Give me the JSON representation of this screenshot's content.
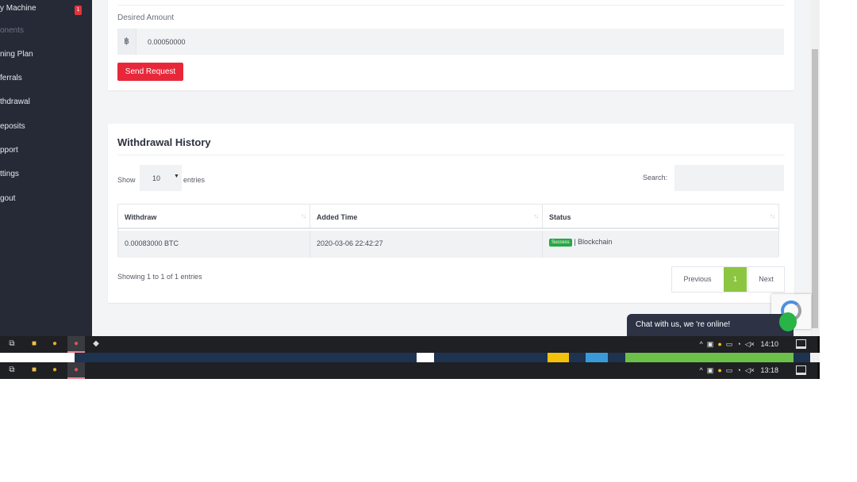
{
  "sidebar": {
    "items": [
      {
        "label": "y Machine",
        "badge": "1"
      },
      {
        "label": "onents"
      },
      {
        "label": "ning Plan"
      },
      {
        "label": "ferrals"
      },
      {
        "label": "thdrawal"
      },
      {
        "label": "eposits"
      },
      {
        "label": "pport"
      },
      {
        "label": "ttings"
      },
      {
        "label": "gout"
      }
    ]
  },
  "request": {
    "desired_label": "Desired Amount",
    "currency_symbol": "฿",
    "amount_value": "0.00050000",
    "send_label": "Send Request"
  },
  "history": {
    "title": "Withdrawal History",
    "show_label": "Show",
    "entries_value": "10",
    "entries_label": "entries",
    "search_label": "Search:",
    "columns": [
      "Withdraw",
      "Added Time",
      "Status"
    ],
    "rows": [
      {
        "withdraw": "0.00083000 BTC",
        "added_time": "2020-03-06 22:42:27",
        "status_badge": "Success",
        "status_text": " | Blockchain"
      }
    ],
    "showing": "Showing 1 to 1 of 1 entries",
    "pagination": {
      "previous": "Previous",
      "current": "1",
      "next": "Next"
    }
  },
  "chat": {
    "label": "Chat with us, we 're online!"
  },
  "taskbar": {
    "time_1": "14:10",
    "time_2": "13:18"
  },
  "colors": {
    "sidebar_bg": "#262a36",
    "primary_red": "#e8283a",
    "success_green": "#27a844",
    "pagination_active": "#8cc53f",
    "chat_bg": "#2d3345"
  }
}
